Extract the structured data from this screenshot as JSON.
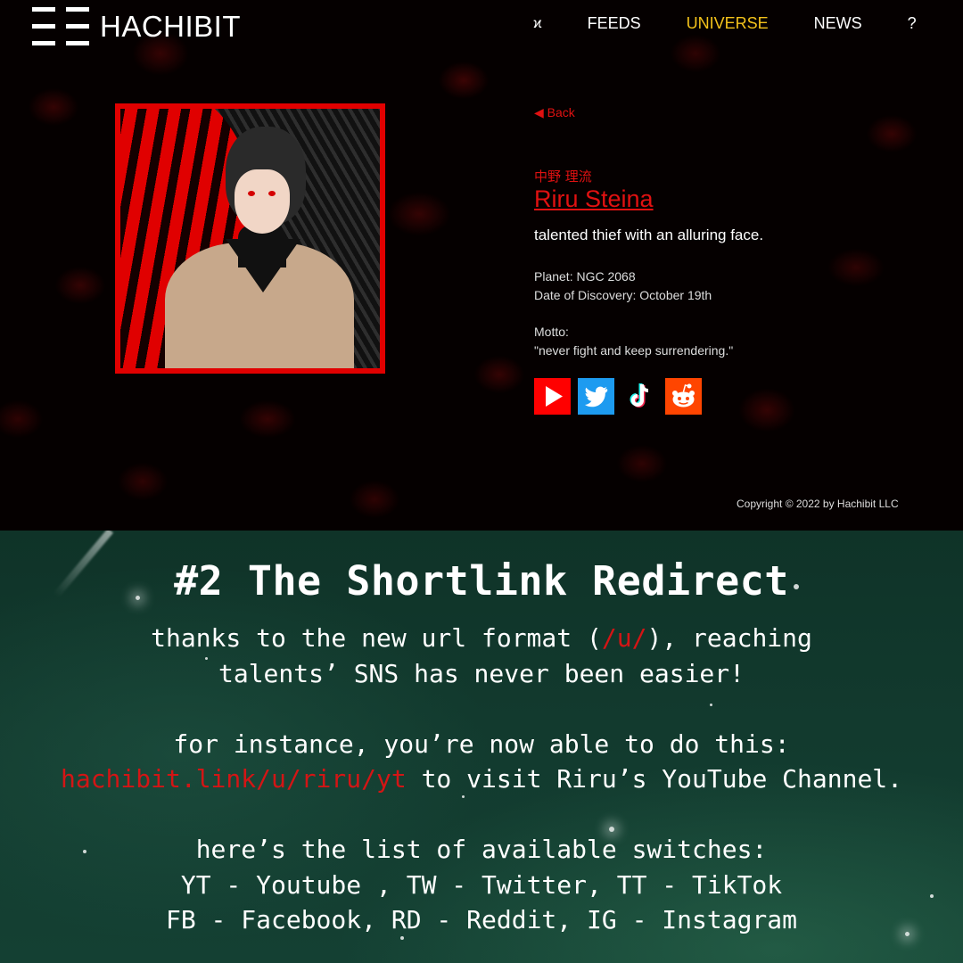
{
  "site": {
    "logo_text": "HACHIBIT",
    "nav": {
      "glyph": "ϰ",
      "items": [
        {
          "label": "FEEDS",
          "active": false
        },
        {
          "label": "UNIVERSE",
          "active": true
        },
        {
          "label": "NEWS",
          "active": false
        },
        {
          "label": "?",
          "active": false
        }
      ],
      "active_color": "#f3c21b"
    },
    "profile": {
      "back_label": "◀ Back",
      "name_native": "中野 理流",
      "name": "Riru Steina",
      "tagline": "talented thief with an alluring face.",
      "planet": "Planet: NGC 2068",
      "discovery": "Date of Discovery: October 19th",
      "motto_label": "Motto:",
      "motto": "\"never fight and keep surrendering.\"",
      "accent_color": "#e01111",
      "socials": [
        {
          "icon": "youtube-icon",
          "color": "#ff0000"
        },
        {
          "icon": "twitter-icon",
          "color": "#1d9bf0"
        },
        {
          "icon": "tiktok-icon",
          "color": "#000000"
        },
        {
          "icon": "reddit-icon",
          "color": "#ff4500"
        }
      ]
    },
    "copyright": "Copyright © 2022 by Hachibit LLC"
  },
  "explainer": {
    "title": "#2 The Shortlink Redirect",
    "line1_a": "thanks to the new url format (",
    "line1_code": "/u/",
    "line1_b": "), reaching",
    "line2": "talents’ SNS has never been easier!",
    "line3": "for instance, you’re now able to do this:",
    "line4_link": "hachibit.link/u/riru/yt",
    "line4_rest": " to visit Riru’s YouTube Channel.",
    "line5": "here’s the list of available switches:",
    "line6": "YT - Youtube , TW - Twitter, TT - TikTok",
    "line7": "FB - Facebook, RD - Reddit, IG - Instagram",
    "highlight_color": "#d31515"
  }
}
